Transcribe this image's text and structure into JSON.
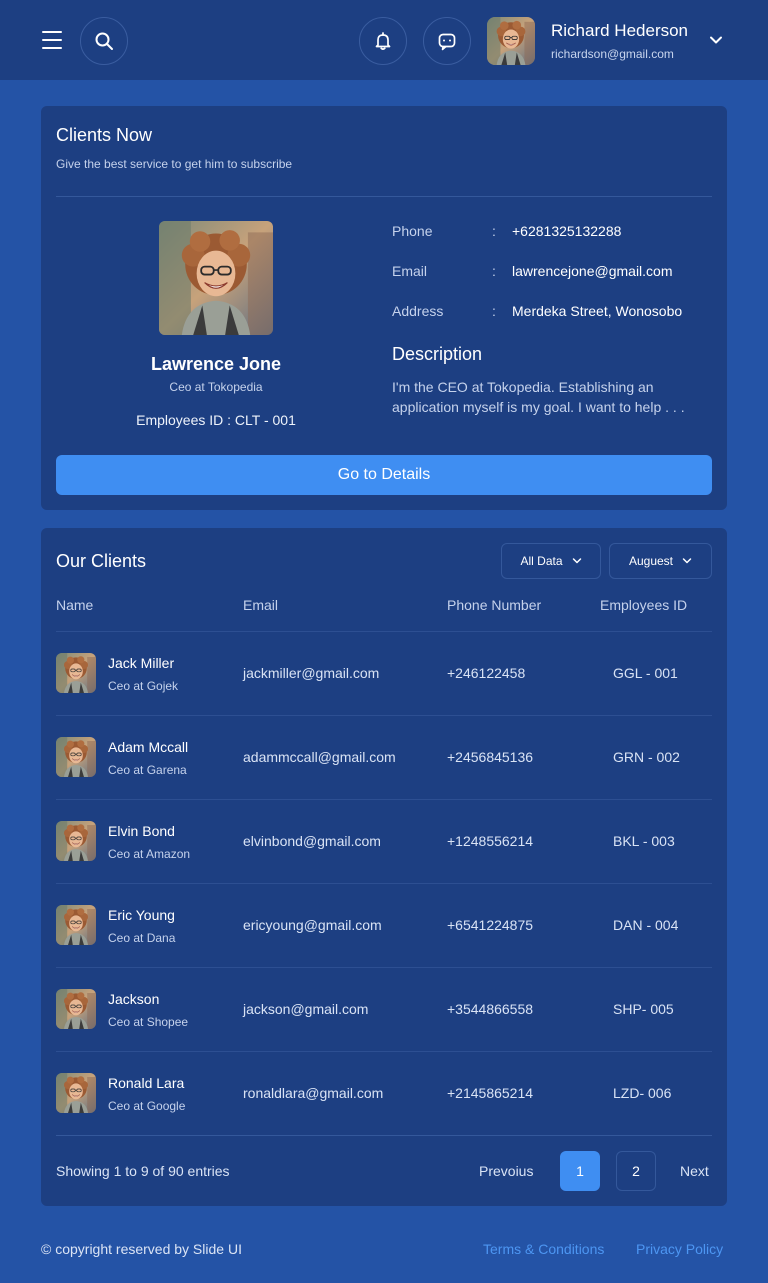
{
  "header": {
    "user_name": "Richard Hederson",
    "user_email": "richardson@gmail.com",
    "icons": [
      "menu-icon",
      "search-icon",
      "bell-icon",
      "chat-icon",
      "chevron-down-icon"
    ]
  },
  "clients_now": {
    "title": "Clients Now",
    "subtitle": "Give the best service to get him to subscribe",
    "client": {
      "name": "Lawrence Jone",
      "role": "Ceo at Tokopedia",
      "employee_id": "Employees ID : CLT - 001"
    },
    "info": [
      {
        "label": "Phone",
        "value": "+6281325132288"
      },
      {
        "label": "Email",
        "value": "lawrencejone@gmail.com"
      },
      {
        "label": "Address",
        "value": "Merdeka Street, Wonosobo"
      }
    ],
    "colon": ":",
    "description_title": "Description",
    "description_lines": [
      "I'm the CEO at Tokopedia. Establishing an",
      "application myself is my goal. I want to help  . . ."
    ],
    "button_label": "Go to Details"
  },
  "our_clients": {
    "title": "Our Clients",
    "filters": {
      "data": "All Data",
      "month": "Auguest"
    },
    "columns": [
      "Name",
      "Email",
      "Phone Number",
      "Employees ID"
    ],
    "rows": [
      {
        "name": "Jack Miller",
        "role": "Ceo at Gojek",
        "email": "jackmiller@gmail.com",
        "phone": "+246122458",
        "id": "GGL - 001"
      },
      {
        "name": "Adam Mccall",
        "role": "Ceo at Garena",
        "email": "adammccall@gmail.com",
        "phone": "+2456845136",
        "id": "GRN - 002"
      },
      {
        "name": "Elvin Bond",
        "role": "Ceo at Amazon",
        "email": "elvinbond@gmail.com",
        "phone": "+1248556214",
        "id": "BKL - 003"
      },
      {
        "name": "Eric Young",
        "role": "Ceo at Dana",
        "email": "ericyoung@gmail.com",
        "phone": "+6541224875",
        "id": "DAN - 004"
      },
      {
        "name": "Jackson",
        "role": "Ceo at Shopee",
        "email": "jackson@gmail.com",
        "phone": "+3544866558",
        "id": "SHP- 005"
      },
      {
        "name": "Ronald Lara",
        "role": "Ceo at Google",
        "email": "ronaldlara@gmail.com",
        "phone": "+2145865214",
        "id": "LZD- 006"
      }
    ],
    "entries_text": "Showing 1 to 9 of 90 entries",
    "pagination": {
      "previous": "Prevoius",
      "pages": [
        "1",
        "2"
      ],
      "current": "1",
      "next": "Next"
    }
  },
  "footer": {
    "copyright": "© copyright reserved by Slide UI",
    "links": [
      "Terms & Conditions",
      "Privacy Policy"
    ]
  },
  "colors": {
    "background": "#2453a6",
    "card": "#1d3f82",
    "accent": "#3f8ef2",
    "link": "#4d96f2"
  }
}
